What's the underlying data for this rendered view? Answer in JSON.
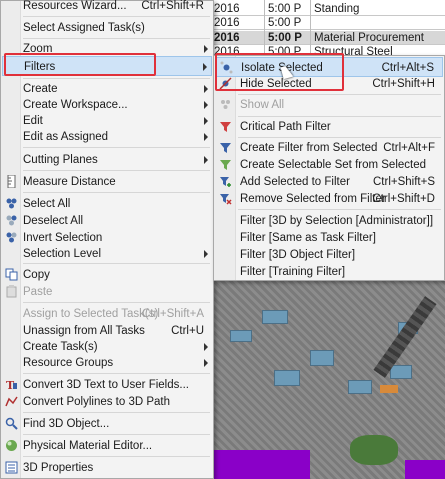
{
  "grid": {
    "rows": [
      {
        "c1": "2016",
        "c2": "5:00 P",
        "c3": "Standing"
      },
      {
        "c1": "2016",
        "c2": "5:00 P",
        "c3": ""
      },
      {
        "c1": "2016",
        "c2": "5:00 P",
        "c3": "Material Procurement"
      },
      {
        "c1": "2016",
        "c2": "5:00 P",
        "c3": "Structural Steel"
      }
    ]
  },
  "main_menu": {
    "items": [
      {
        "label": "Resources Wizard...",
        "shortcut": "Ctrl+Shift+R"
      },
      {
        "label": "Select Assigned Task(s)"
      },
      {
        "label": "Zoom"
      },
      {
        "label": "Filters"
      },
      {
        "label": "Create"
      },
      {
        "label": "Create Workspace..."
      },
      {
        "label": "Edit"
      },
      {
        "label": "Edit as Assigned"
      },
      {
        "label": "Cutting Planes"
      },
      {
        "label": "Measure Distance"
      },
      {
        "label": "Select All"
      },
      {
        "label": "Deselect All"
      },
      {
        "label": "Invert Selection"
      },
      {
        "label": "Selection Level"
      },
      {
        "label": "Copy"
      },
      {
        "label": "Paste"
      },
      {
        "label": "Assign to Selected Task(s)",
        "shortcut": "Ctrl+Shift+A"
      },
      {
        "label": "Unassign from All Tasks",
        "shortcut": "Ctrl+U"
      },
      {
        "label": "Create Task(s)"
      },
      {
        "label": "Resource Groups"
      },
      {
        "label": "Convert 3D Text to User Fields..."
      },
      {
        "label": "Convert Polylines to 3D Path"
      },
      {
        "label": "Find 3D Object..."
      },
      {
        "label": "Physical Material Editor..."
      },
      {
        "label": "3D Properties"
      }
    ]
  },
  "sub_menu": {
    "items": [
      {
        "label": "Isolate Selected",
        "shortcut": "Ctrl+Alt+S"
      },
      {
        "label": "Hide Selected",
        "shortcut": "Ctrl+Shift+H"
      },
      {
        "label": "Show All"
      },
      {
        "label": "Critical Path Filter"
      },
      {
        "label": "Create Filter from Selected",
        "shortcut": "Ctrl+Alt+F"
      },
      {
        "label": "Create Selectable Set from Selected"
      },
      {
        "label": "Add Selected to Filter",
        "shortcut": "Ctrl+Shift+S"
      },
      {
        "label": "Remove Selected from Filter",
        "shortcut": "Ctrl+Shift+D"
      },
      {
        "label": "Filter [3D by Selection [Administrator]]"
      },
      {
        "label": "Filter [Same as Task Filter]"
      },
      {
        "label": "Filter [3D Object Filter]"
      },
      {
        "label": "Filter [Training Filter]"
      }
    ]
  },
  "colors": {
    "highlight": "#cfe3f7",
    "annotation": "#e0303a",
    "model_accent": "#8a00c8"
  }
}
